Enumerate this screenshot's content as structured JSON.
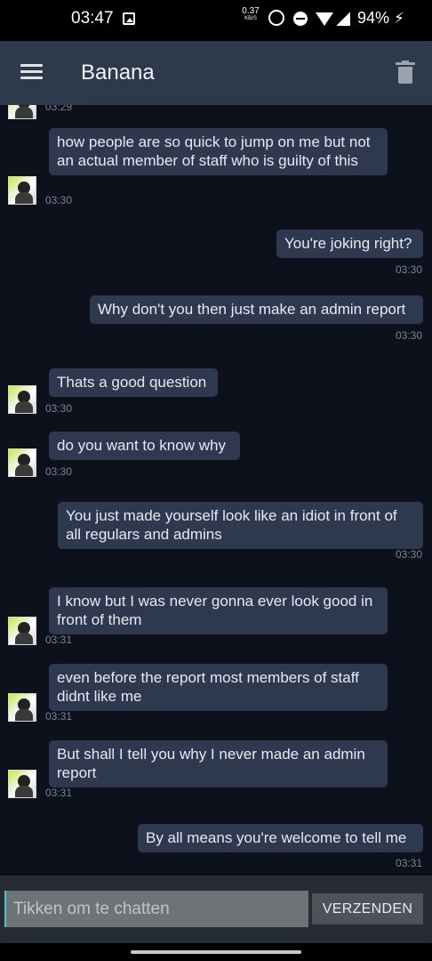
{
  "status_bar": {
    "time": "03:47",
    "net_speed": "0.37",
    "net_unit": "KB/S",
    "battery": "94%",
    "icons": [
      "image-icon",
      "alarm-icon",
      "dnd-icon",
      "wifi-icon",
      "signal-icon",
      "bolt-icon"
    ]
  },
  "header": {
    "title": "Banana",
    "menu_icon": "menu-icon",
    "delete_icon": "trash-icon"
  },
  "colors": {
    "background": "#0c111b",
    "app_bar": "#2d3a4c",
    "bubble": "#2e3950",
    "timestamp": "#7b8595"
  },
  "messages": [
    {
      "side": "left",
      "time": "03:29",
      "text": ""
    },
    {
      "side": "left",
      "time": "03:30",
      "text": "how people are so quick to jump on me but not an actual member of staff who is guilty of this"
    },
    {
      "side": "right",
      "time": "03:30",
      "text": "You're joking right?"
    },
    {
      "side": "right",
      "time": "03:30",
      "text": "Why don't you then just make an admin report"
    },
    {
      "side": "left",
      "time": "03:30",
      "text": "Thats a good question"
    },
    {
      "side": "left",
      "time": "03:30",
      "text": "do you want to know why"
    },
    {
      "side": "right",
      "time": "03:30",
      "text": "You just made yourself look like an idiot in front of all regulars and admins"
    },
    {
      "side": "left",
      "time": "03:31",
      "text": "I know but I was never gonna ever look good in front of them"
    },
    {
      "side": "left",
      "time": "03:31",
      "text": "even before the report most members of staff didnt like me"
    },
    {
      "side": "left",
      "time": "03:31",
      "text": "But shall I tell you why I never made an admin report"
    },
    {
      "side": "right",
      "time": "03:31",
      "text": "By all means you're welcome to tell me"
    }
  ],
  "composer": {
    "placeholder": "Tikken om te chatten",
    "send_label": "VERZENDEN"
  }
}
